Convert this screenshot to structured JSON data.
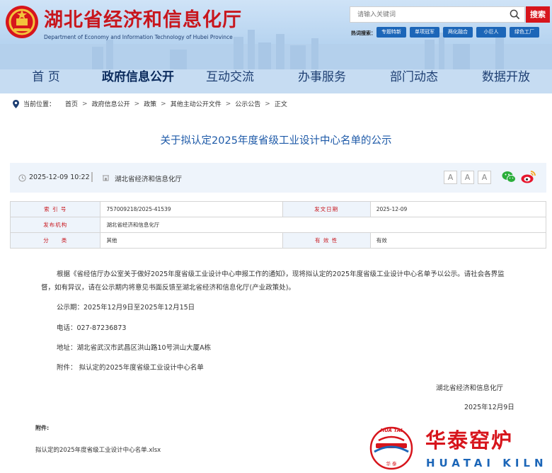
{
  "header": {
    "title": "湖北省经济和信息化厅",
    "title_en": "Department of Economy and Information Technology of Hubei Province",
    "search_placeholder": "请输入关键词",
    "search_button": "搜索",
    "hot_label": "热词搜索：",
    "hot_tags": [
      "专题特新",
      "单项冠军",
      "两化融合",
      "小巨人",
      "绿色工厂"
    ]
  },
  "nav": [
    "首 页",
    "政府信息公开",
    "互动交流",
    "办事服务",
    "部门动态",
    "数据开放"
  ],
  "breadcrumb": {
    "label": "当前位置：",
    "items": [
      "首页",
      "政府信息公开",
      "政策",
      "其他主动公开文件",
      "公示公告",
      "正文"
    ],
    "sep": ">"
  },
  "article": {
    "title": "关于拟认定2025年度省级工业设计中心名单的公示",
    "date": "2025-12-09 10:22",
    "source": "湖北省经济和信息化厅",
    "font_buttons": [
      "A",
      "A",
      "A"
    ]
  },
  "info": {
    "index_label": "索 引 号",
    "index_value": "757009218/2025-41539",
    "date_label": "发文日期",
    "date_value": "2025-12-09",
    "org_label": "发布机构",
    "org_value": "湖北省经济和信息化厅",
    "cat_label": "分　　类",
    "cat_value": "其他",
    "valid_label": "有 效 性",
    "valid_value": "有效"
  },
  "body": {
    "para1": "根据《省经信厅办公室关于做好2025年度省级工业设计中心申报工作的通知》，现将拟认定的2025年度省级工业设计中心名单予以公示。请社会各界监督，如有异议，请在公示期内将意见书面反馈至湖北省经济和信息化厅(产业政策处)。",
    "period": "公示期：2025年12月9日至2025年12月15日",
    "phone": "电话：027-87236873",
    "address": "地址：湖北省武汉市武昌区洪山路10号洪山大厦A栋",
    "attachment_line": "附件： 拟认定的2025年度省级工业设计中心名单",
    "sign_org": "湖北省经济和信息化厅",
    "sign_date": "2025年12月9日",
    "attach_label": "附件:",
    "attach_file": "拟认定的2025年度省级工业设计中心名单.xlsx"
  },
  "watermark": {
    "cn": "华泰窑炉",
    "en": "HUATAI KILN",
    "arc": "HUA TAI",
    "small": "华  泰"
  },
  "colors": {
    "brand_red": "#c8161d",
    "nav_blue": "#1e3f73",
    "tag_blue": "#1c66b8",
    "title_blue": "#1e5aa8"
  }
}
